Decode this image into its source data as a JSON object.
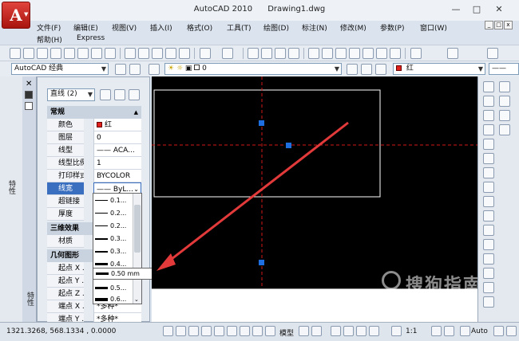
{
  "window": {
    "title": "AutoCAD 2010",
    "document": "Drawing1.dwg",
    "logo": "A",
    "minimize_icon": "minimize-icon",
    "maximize_icon": "maximize-icon",
    "close_icon": "close-icon"
  },
  "menu": {
    "row1": [
      "文件(F)",
      "编辑(E)",
      "视图(V)",
      "插入(I)",
      "格式(O)",
      "工具(T)",
      "绘图(D)",
      "标注(N)",
      "修改(M)",
      "参数(P)",
      "窗口(W)"
    ],
    "row2": [
      "帮助(H)",
      "Express"
    ]
  },
  "toolbar2": {
    "workspace": "AutoCAD 经典",
    "layer_value": "0",
    "color_value": "红"
  },
  "properties": {
    "palette_title": "特性",
    "object_type": "直线 (2)",
    "sections": {
      "general": "常规",
      "threed": "三维效果",
      "geometry": "几何图形"
    },
    "general_rows": [
      {
        "key": "颜色",
        "value": "红"
      },
      {
        "key": "图层",
        "value": "0"
      },
      {
        "key": "线型",
        "value": "—— ACA..."
      },
      {
        "key": "线型比例",
        "value": "1"
      },
      {
        "key": "打印样式",
        "value": "BYCOLOR"
      },
      {
        "key": "线宽",
        "value": "—— ByL..."
      },
      {
        "key": "超链接",
        "value": ""
      },
      {
        "key": "厚度",
        "value": ""
      }
    ],
    "threed_rows": [
      {
        "key": "材质",
        "value": ""
      }
    ],
    "geometry_rows": [
      {
        "key": "起点 X ...",
        "value": ""
      },
      {
        "key": "起点 Y ...",
        "value": ""
      },
      {
        "key": "起点 Z ...",
        "value": ""
      },
      {
        "key": "端点 X ...",
        "value": "*多种*"
      },
      {
        "key": "端点 Y ...",
        "value": "*多种*"
      }
    ],
    "left_strip_label": "特性"
  },
  "lineweight_list": {
    "items": [
      "—— 0.1...",
      "—— 0.2...",
      "—— 0.2...",
      "—— 0.3...",
      "—— 0.3...",
      "—— 0.4...",
      "—— 0.5...",
      "—— 0.6..."
    ],
    "highlight": "0.50 mm"
  },
  "status": {
    "coords": "1321.3268, 568.1334 , 0.0000",
    "model_label": "模型",
    "scale_label": "1:1",
    "auto_label": "Auto"
  },
  "watermark": {
    "text": "搜狗指南",
    "sub": "zhinan.sogou.com"
  },
  "colors": {
    "accent_red": "#e0201b",
    "canvas": "#000000",
    "grip_blue": "#1e6ee0",
    "arrow_red": "#e23a3a"
  }
}
